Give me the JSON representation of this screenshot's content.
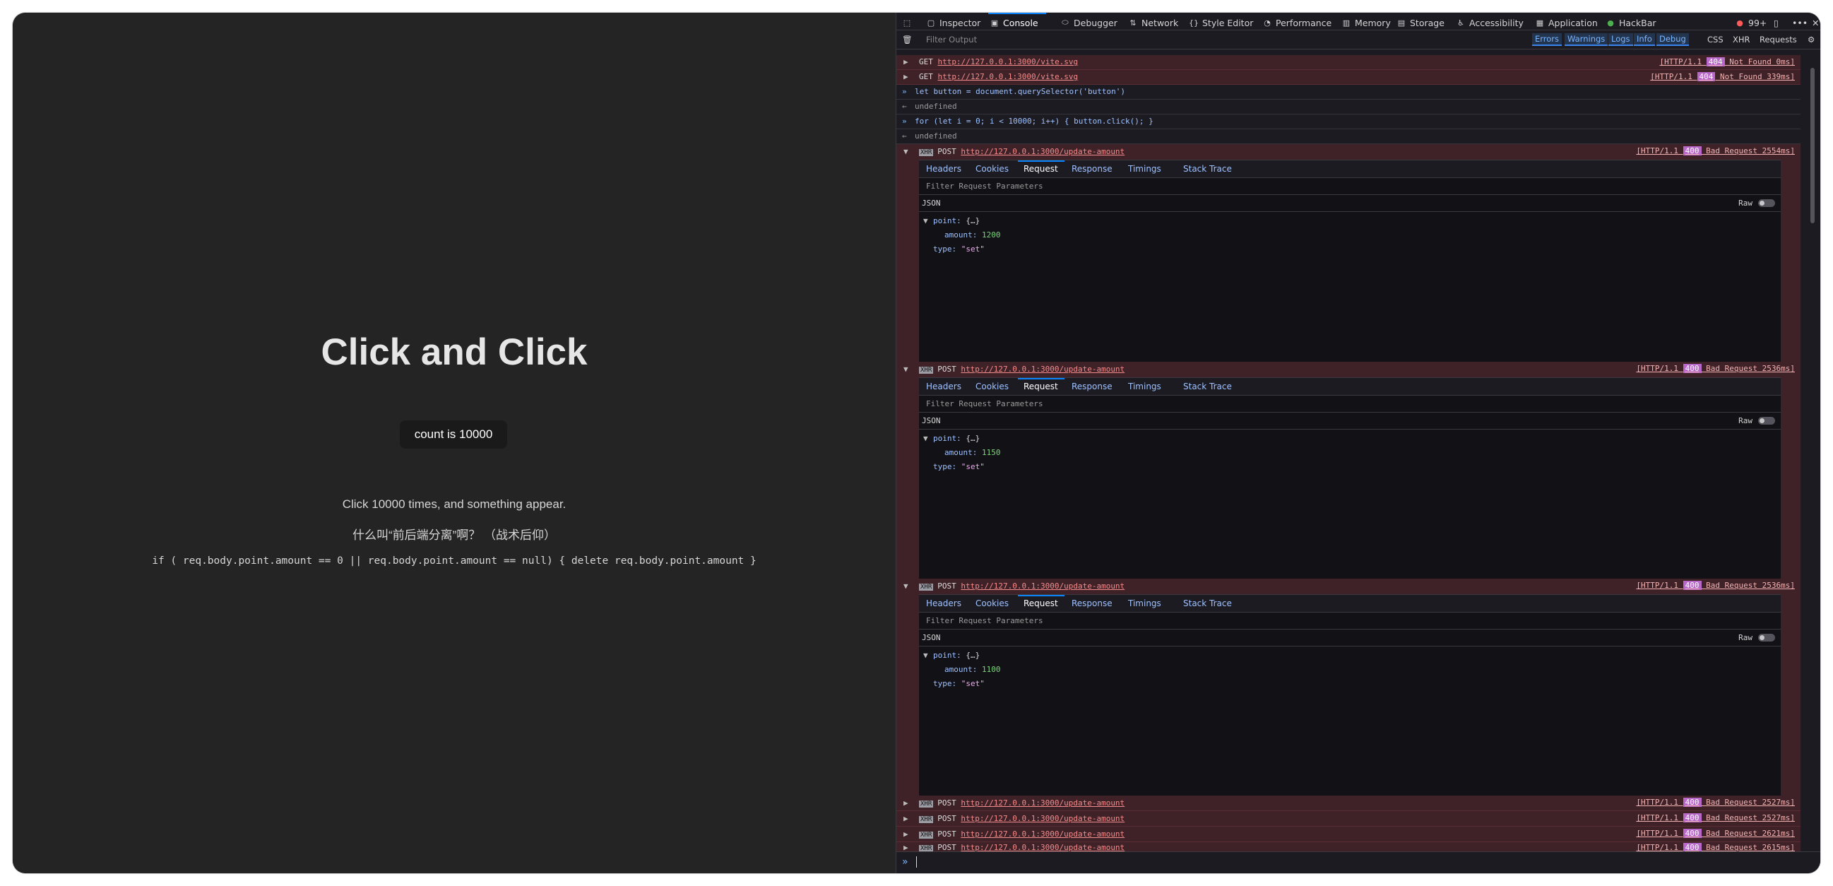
{
  "app": {
    "title": "Click and Click",
    "count_label": "count is 10000",
    "desc1": "Click 10000 times, and something appear.",
    "desc2": "什么叫“前后端分离”啊？ （战术后仰）",
    "code": "if ( req.body.point.amount == 0 || req.body.point.amount == null) { delete req.body.point.amount }"
  },
  "devtools": {
    "tabs": {
      "inspector": "Inspector",
      "console": "Console",
      "debugger": "Debugger",
      "network": "Network",
      "style_editor": "Style Editor",
      "performance": "Performance",
      "memory": "Memory",
      "storage": "Storage",
      "accessibility": "Accessibility",
      "application": "Application",
      "hackbar": "HackBar"
    },
    "error_count": "99+",
    "filter_placeholder": "Filter Output",
    "filters": {
      "errors": "Errors",
      "warnings": "Warnings",
      "logs": "Logs",
      "info": "Info",
      "debug": "Debug",
      "css": "CSS",
      "xhr": "XHR",
      "requests": "Requests"
    },
    "get_rows": [
      {
        "method": "GET",
        "url": "http://127.0.0.1:3000/vite.svg",
        "proto": "[HTTP/1.1 ",
        "status": "404",
        "text": " Not Found 0ms]"
      },
      {
        "method": "GET",
        "url": "http://127.0.0.1:3000/vite.svg",
        "proto": "[HTTP/1.1 ",
        "status": "404",
        "text": " Not Found 339ms]"
      }
    ],
    "commands": [
      {
        "input": "let button = document.querySelector('button')",
        "output": "undefined"
      },
      {
        "input": "for (let i = 0; i < 10000; i++) { button.click(); }",
        "output": "undefined"
      }
    ],
    "xhr_tag": "XHR",
    "panel_tabs": {
      "headers": "Headers",
      "cookies": "Cookies",
      "request": "Request",
      "response": "Response",
      "timings": "Timings",
      "stack": "Stack Trace"
    },
    "filter_params": "Filter Request Parameters",
    "json_label": "JSON",
    "raw_label": "Raw",
    "point_key": "point: ",
    "point_val": "{…}",
    "amount_key": "amount: ",
    "type_key": "type: ",
    "type_val": "\"set\"",
    "expanded": [
      {
        "method": "POST",
        "url": "http://127.0.0.1:3000/update-amount",
        "proto": "[HTTP/1.1 ",
        "status": "400",
        "text": " Bad Request 2554ms]",
        "amount": "1200"
      },
      {
        "method": "POST",
        "url": "http://127.0.0.1:3000/update-amount",
        "proto": "[HTTP/1.1 ",
        "status": "400",
        "text": " Bad Request 2536ms]",
        "amount": "1150"
      },
      {
        "method": "POST",
        "url": "http://127.0.0.1:3000/update-amount",
        "proto": "[HTTP/1.1 ",
        "status": "400",
        "text": " Bad Request 2536ms]",
        "amount": "1100"
      }
    ],
    "collapsed": [
      {
        "method": "POST",
        "url": "http://127.0.0.1:3000/update-amount",
        "proto": "[HTTP/1.1 ",
        "status": "400",
        "text": " Bad Request 2527ms]"
      },
      {
        "method": "POST",
        "url": "http://127.0.0.1:3000/update-amount",
        "proto": "[HTTP/1.1 ",
        "status": "400",
        "text": " Bad Request 2527ms]"
      },
      {
        "method": "POST",
        "url": "http://127.0.0.1:3000/update-amount",
        "proto": "[HTTP/1.1 ",
        "status": "400",
        "text": " Bad Request 2621ms]"
      },
      {
        "method": "POST",
        "url": "http://127.0.0.1:3000/update-amount",
        "proto": "[HTTP/1.1 ",
        "status": "400",
        "text": " Bad Request 2615ms]"
      }
    ]
  }
}
